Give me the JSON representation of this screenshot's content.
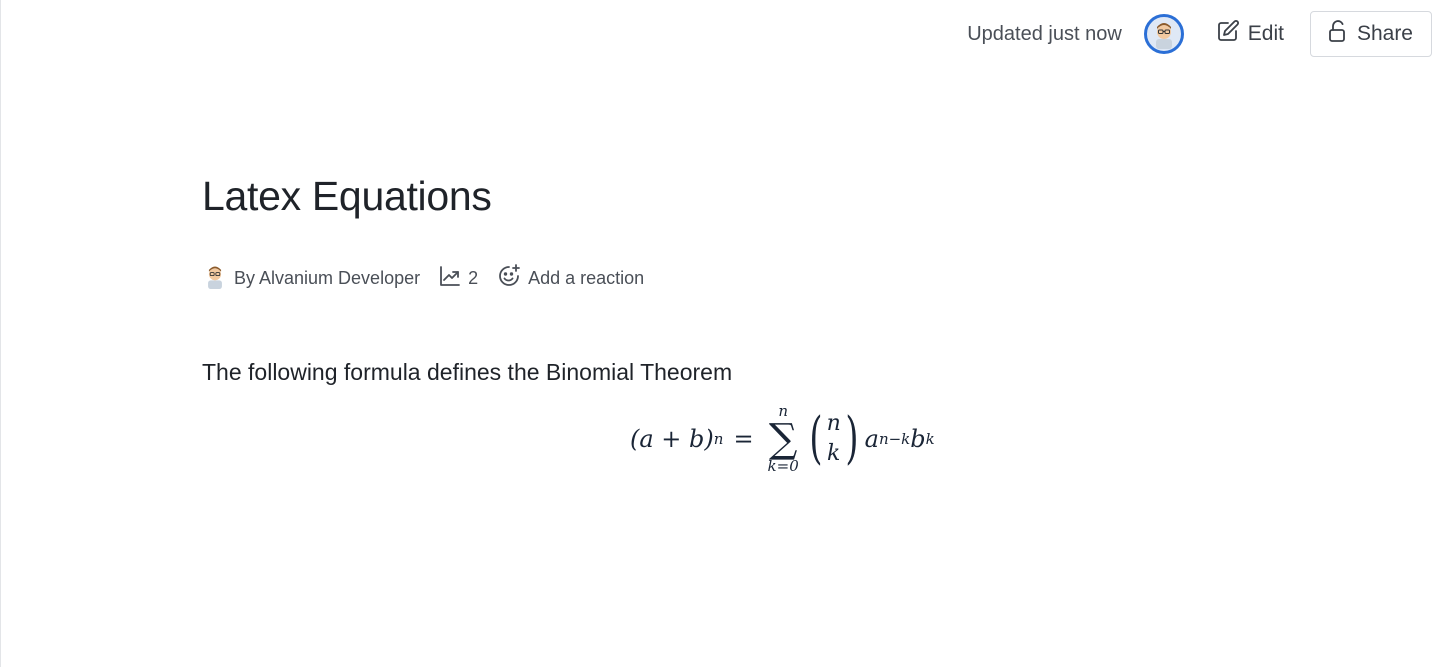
{
  "header": {
    "updated_text": "Updated just now",
    "edit_label": "Edit",
    "share_label": "Share",
    "avatar_icon": "developer-avatar-icon",
    "edit_icon": "pencil-edit-icon",
    "share_icon": "unlock-icon",
    "avatar_ring_color": "#2b6fd6"
  },
  "page": {
    "title": "Latex Equations",
    "meta": {
      "author": "By Alvanium Developer",
      "views_count": "2",
      "reaction_label": "Add a reaction"
    },
    "body_text": "The following formula defines the Binomial Theorem",
    "equation": {
      "lhs_open": "(a + b)",
      "lhs_exp": "n",
      "equals": "=",
      "sum_upper": "n",
      "sum_symbol": "∑",
      "sum_lower": "k=0",
      "binom_top": "n",
      "binom_bottom": "k",
      "term_a": "a",
      "term_a_exp": "n−k",
      "term_b": "b",
      "term_b_exp": "k"
    }
  }
}
